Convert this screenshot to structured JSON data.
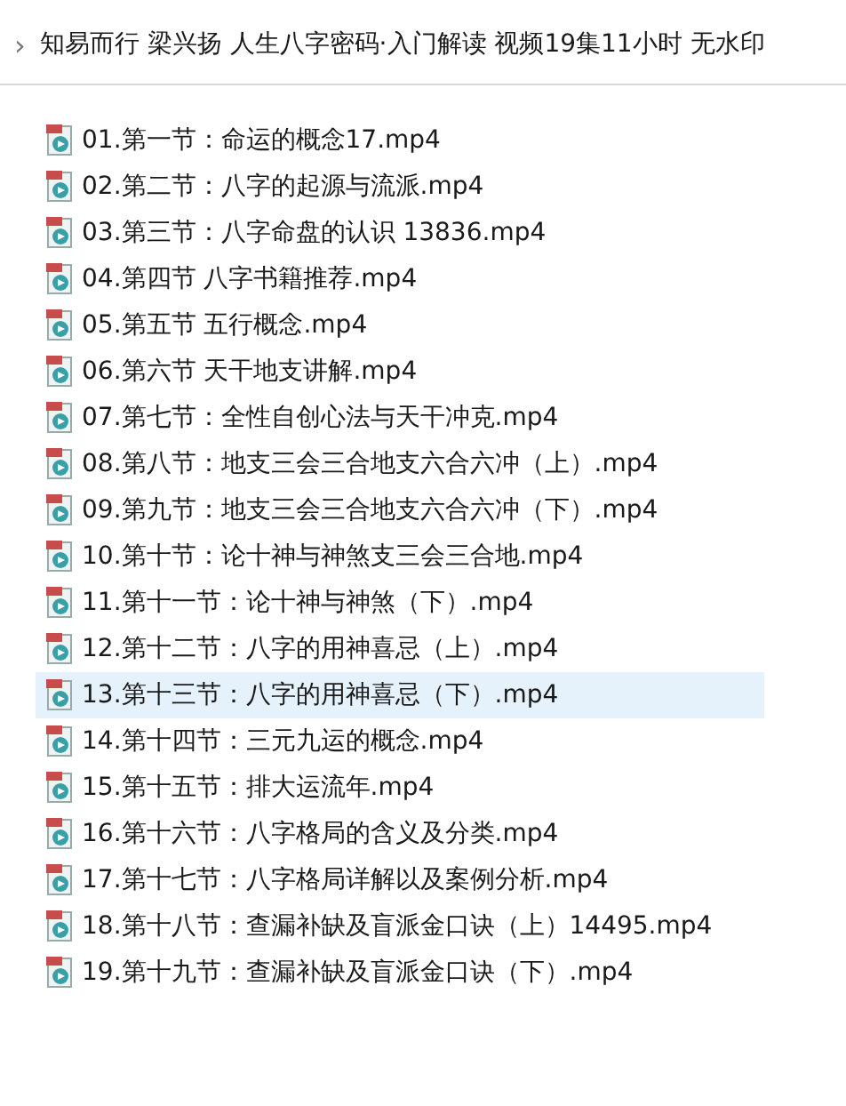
{
  "breadcrumb": {
    "separator": "›",
    "path": "知易而行 梁兴扬 人生八字密码·入门解读 视频19集11小时 无水印"
  },
  "files": [
    {
      "name": "01.第一节：命运的概念17.mp4",
      "selected": false
    },
    {
      "name": "02.第二节：八字的起源与流派.mp4",
      "selected": false
    },
    {
      "name": "03.第三节：八字命盘的认识  13836.mp4",
      "selected": false
    },
    {
      "name": "04.第四节 八字书籍推荐.mp4",
      "selected": false
    },
    {
      "name": "05.第五节 五行概念.mp4",
      "selected": false
    },
    {
      "name": "06.第六节 天干地支讲解.mp4",
      "selected": false
    },
    {
      "name": "07.第七节：全性自创心法与天干冲克.mp4",
      "selected": false
    },
    {
      "name": "08.第八节：地支三会三合地支六合六冲（上）.mp4",
      "selected": false
    },
    {
      "name": "09.第九节：地支三会三合地支六合六冲（下）.mp4",
      "selected": false
    },
    {
      "name": "10.第十节：论十神与神煞支三会三合地.mp4",
      "selected": false
    },
    {
      "name": "11.第十一节：论十神与神煞（下）.mp4",
      "selected": false
    },
    {
      "name": "12.第十二节：八字的用神喜忌（上）.mp4",
      "selected": false
    },
    {
      "name": "13.第十三节：八字的用神喜忌（下）.mp4",
      "selected": true
    },
    {
      "name": "14.第十四节：三元九运的概念.mp4",
      "selected": false
    },
    {
      "name": "15.第十五节：排大运流年.mp4",
      "selected": false
    },
    {
      "name": "16.第十六节：八字格局的含义及分类.mp4",
      "selected": false
    },
    {
      "name": "17.第十七节：八字格局详解以及案例分析.mp4",
      "selected": false
    },
    {
      "name": "18.第十八节：查漏补缺及盲派金口诀（上）14495.mp4",
      "selected": false
    },
    {
      "name": "19.第十九节：查漏补缺及盲派金口诀（下）.mp4",
      "selected": false
    }
  ]
}
